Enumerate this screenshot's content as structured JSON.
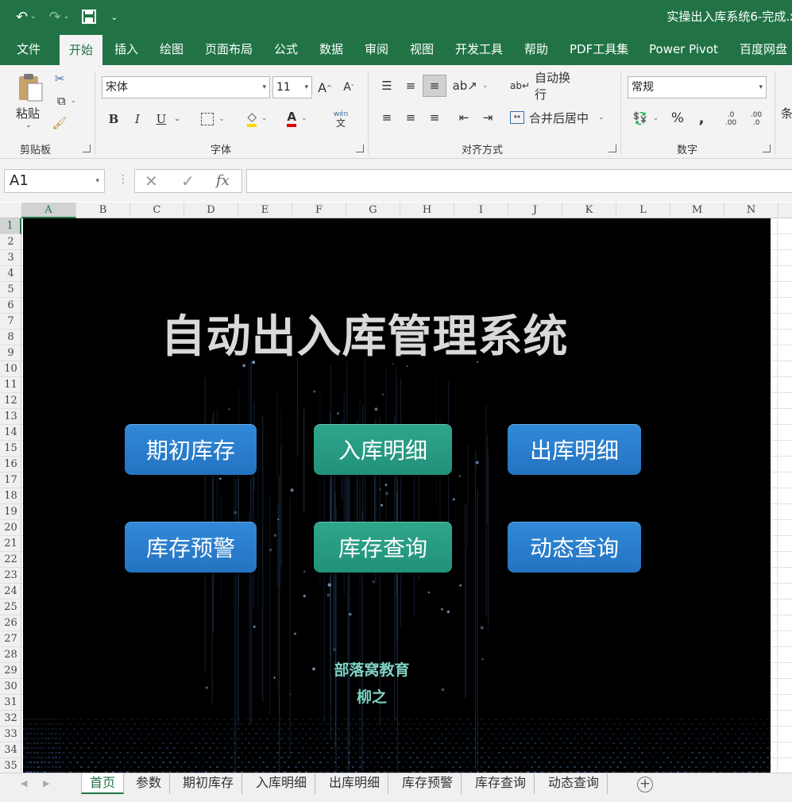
{
  "window": {
    "title": "实操出入库系统6-完成.x"
  },
  "menu_tabs": [
    "文件",
    "开始",
    "插入",
    "绘图",
    "页面布局",
    "公式",
    "数据",
    "审阅",
    "视图",
    "开发工具",
    "帮助",
    "PDF工具集",
    "Power Pivot",
    "百度网盘"
  ],
  "active_tab": "开始",
  "ribbon": {
    "clipboard": {
      "label": "剪贴板",
      "paste": "粘贴"
    },
    "font": {
      "label": "字体",
      "name": "宋体",
      "size": "11",
      "bold": "B",
      "italic": "I",
      "underline": "U",
      "phonetic_top": "wén",
      "phonetic_bottom": "文"
    },
    "alignment": {
      "label": "对齐方式",
      "wrap_text": "自动换行",
      "merge_center": "合并后居中"
    },
    "number": {
      "label": "数字",
      "format": "常规",
      "percent": "%",
      "comma": ",",
      "inc_decimal": ".0",
      "inc_decimal_b": ".00",
      "dec_decimal": ".00",
      "dec_decimal_b": ".0"
    },
    "cut_off": "条"
  },
  "formula_bar": {
    "name_box": "A1",
    "fx": "fx",
    "value": ""
  },
  "columns": [
    "A",
    "B",
    "C",
    "D",
    "E",
    "F",
    "G",
    "H",
    "I",
    "J",
    "K",
    "L",
    "M",
    "N"
  ],
  "rows": [
    "1",
    "2",
    "3",
    "4",
    "5",
    "6",
    "7",
    "8",
    "9",
    "10",
    "11",
    "12",
    "13",
    "14",
    "15",
    "16",
    "17",
    "18",
    "19",
    "20",
    "21",
    "22",
    "23",
    "24",
    "25",
    "26",
    "27",
    "28",
    "29",
    "30",
    "31",
    "32",
    "33",
    "34",
    "35"
  ],
  "dashboard": {
    "title": "自动出入库管理系统",
    "buttons": {
      "opening_stock": "期初库存",
      "inbound_detail": "入库明细",
      "outbound_detail": "出库明细",
      "stock_alert": "库存预警",
      "stock_query": "库存查询",
      "dynamic_query": "动态查询"
    },
    "credit_org": "部落窝教育",
    "credit_author": "柳之",
    "colors": {
      "blue_button": "#2a7ccb",
      "teal_button": "#26997f",
      "credit_text": "#7fd3c4"
    }
  },
  "sheet_tabs": [
    "首页",
    "参数",
    "期初库存",
    "入库明细",
    "出库明细",
    "库存预警",
    "库存查询",
    "动态查询"
  ],
  "active_sheet": "首页",
  "colors": {
    "excel_green": "#217346"
  }
}
